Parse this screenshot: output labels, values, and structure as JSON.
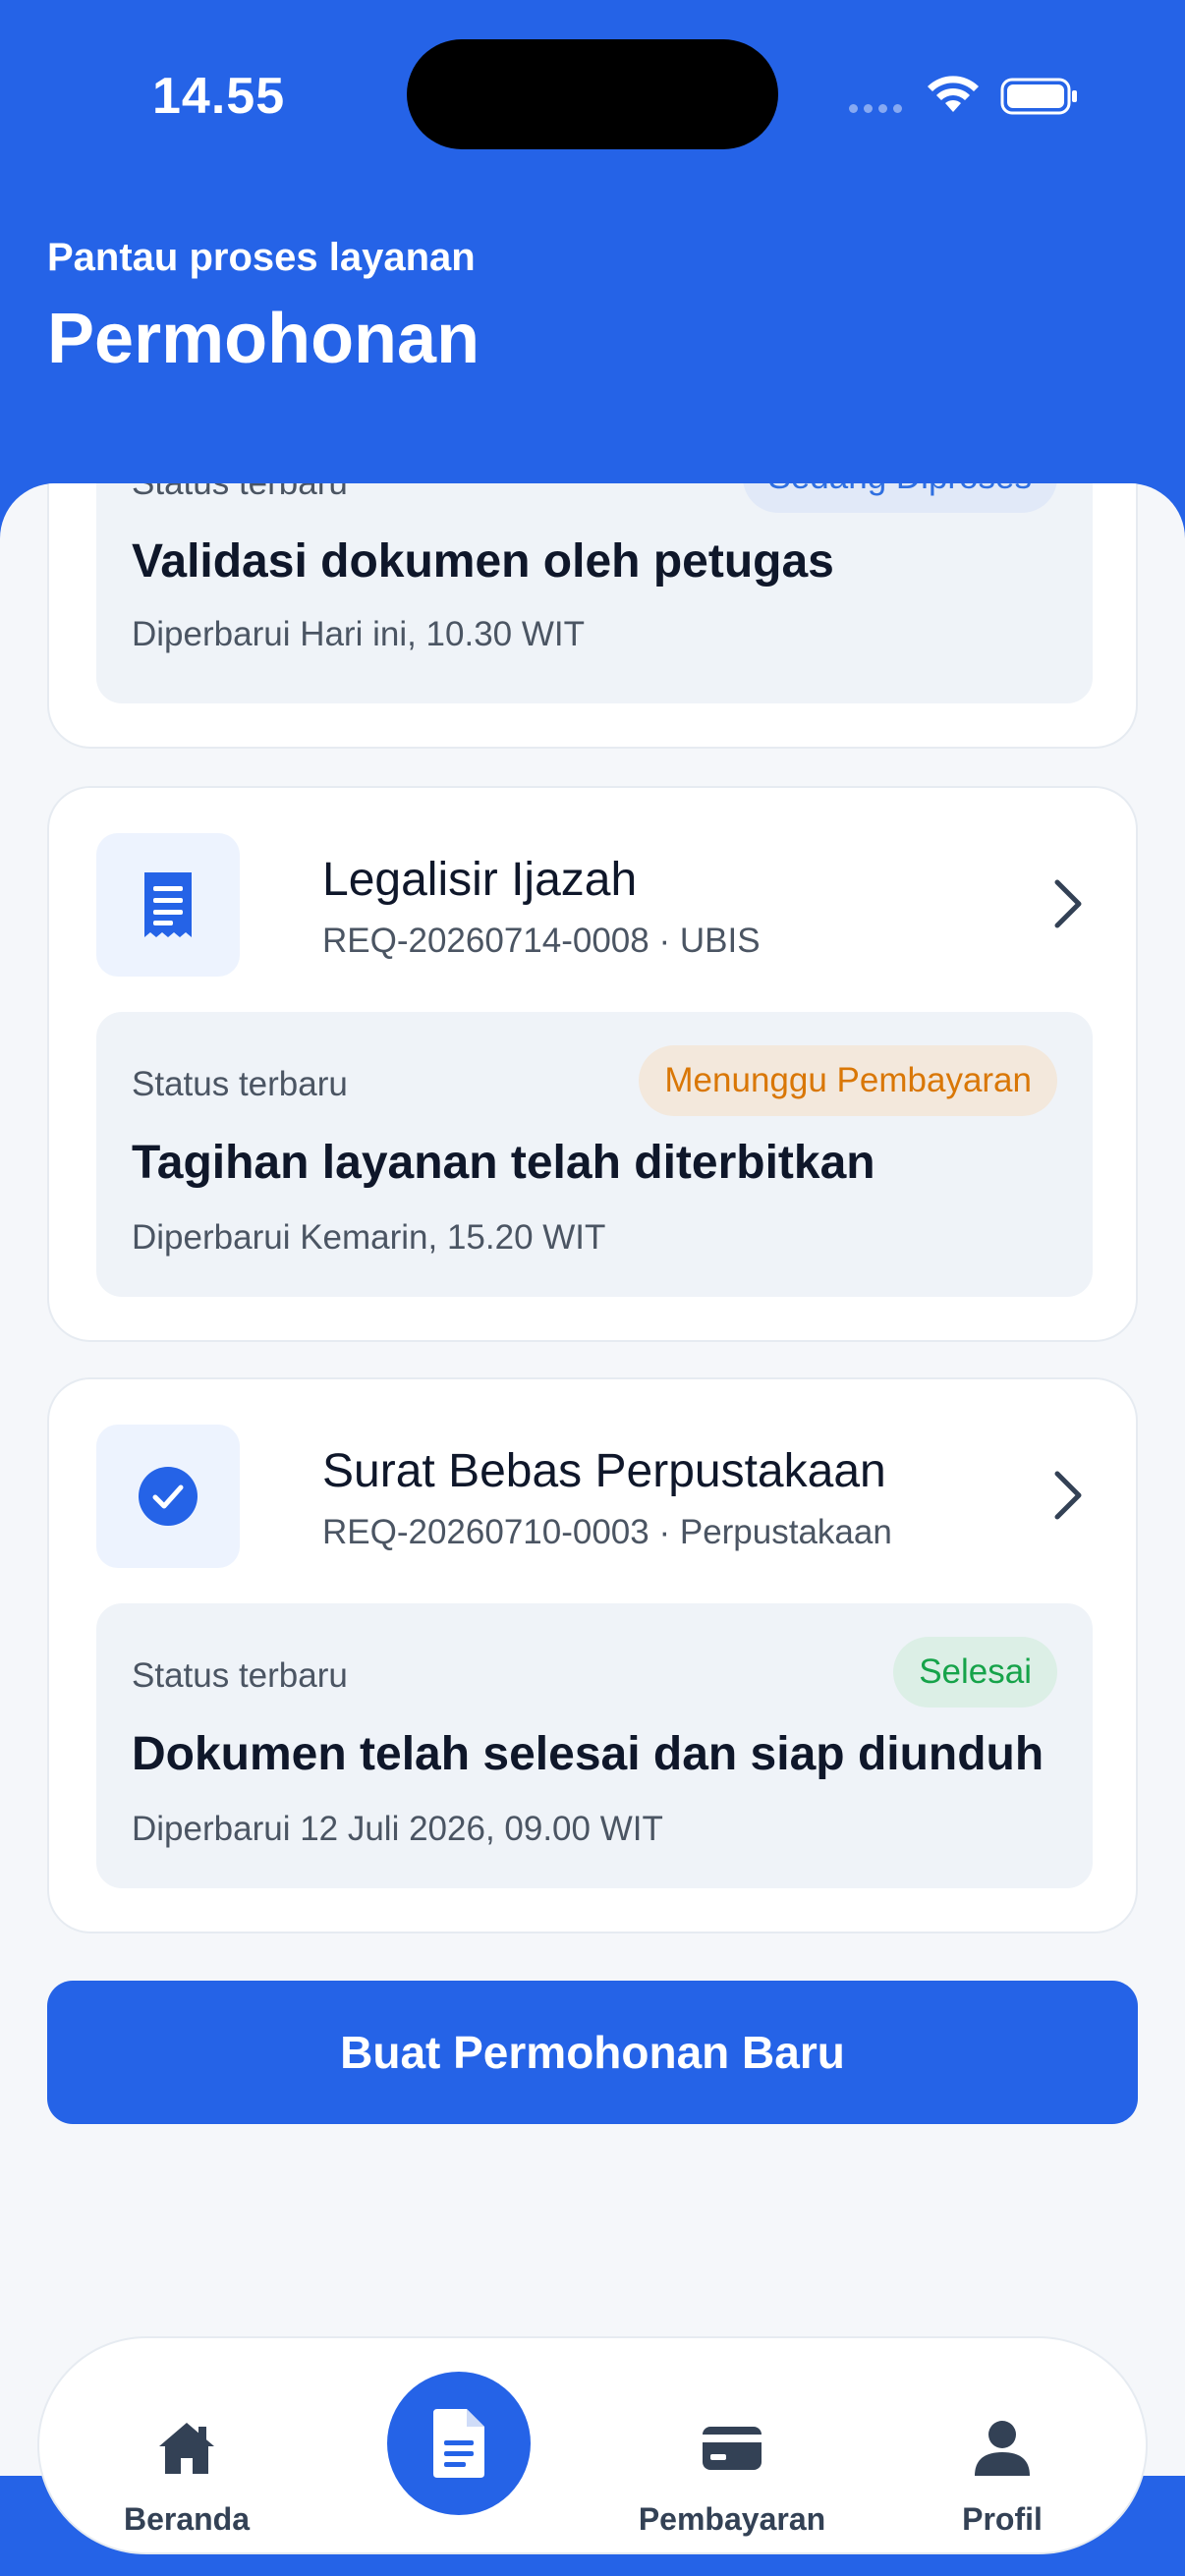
{
  "status_bar": {
    "time": "14.55"
  },
  "header": {
    "subtitle": "Pantau proses layanan",
    "title": "Permohonan"
  },
  "requests": [
    {
      "status_label": "Status terbaru",
      "badge": "Sedang Diproses",
      "status_text": "Validasi dokumen oleh petugas",
      "updated": "Diperbarui Hari ini, 10.30 WIT",
      "badge_color": "#2f6fe0",
      "badge_bg": "#e1e9f8"
    },
    {
      "title": "Legalisir Ijazah",
      "meta": "REQ-20260714-0008 · UBIS",
      "icon": "receipt-icon",
      "status_label": "Status terbaru",
      "badge": "Menunggu Pembayaran",
      "status_text": "Tagihan layanan telah diterbitkan",
      "updated": "Diperbarui Kemarin, 15.20 WIT",
      "badge_color": "#d97706",
      "badge_bg": "#f3e8dc"
    },
    {
      "title": "Surat Bebas Perpustakaan",
      "meta": "REQ-20260710-0003 · Perpustakaan",
      "icon": "check-circle-icon",
      "status_label": "Status terbaru",
      "badge": "Selesai",
      "status_text": "Dokumen telah selesai dan siap diunduh",
      "updated": "Diperbarui 12 Juli 2026, 09.00 WIT",
      "badge_color": "#16a34a",
      "badge_bg": "#dcefe6"
    }
  ],
  "actions": {
    "new_request": "Buat Permohonan Baru"
  },
  "bottom_nav": {
    "home": "Beranda",
    "payments": "Pembayaran",
    "profile": "Profil",
    "center_icon": "document-icon"
  },
  "colors": {
    "primary": "#2563e7",
    "background": "#f5f7fa"
  }
}
